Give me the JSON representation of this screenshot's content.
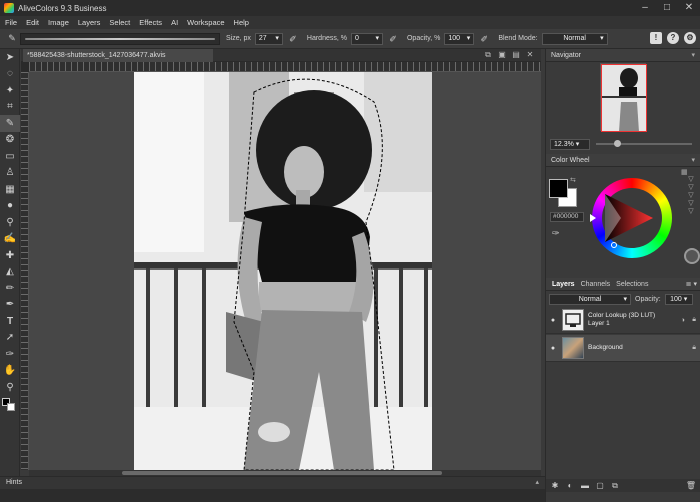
{
  "window": {
    "title": "AliveColors 9.3 Business",
    "min": "–",
    "max": "□",
    "close": "✕"
  },
  "menu": [
    "File",
    "Edit",
    "Image",
    "Layers",
    "Select",
    "Effects",
    "AI",
    "Workspace",
    "Help"
  ],
  "options": {
    "size_label": "Size, px",
    "size_value": "27",
    "hardness_label": "Hardness, %",
    "hardness_value": "0",
    "opacity_label": "Opacity, %",
    "opacity_value": "100",
    "blend_label": "Blend Mode:",
    "blend_value": "Normal"
  },
  "document": {
    "tab_title": "*588425438-shutterstock_1427036477.akvis"
  },
  "panels": {
    "navigator": "Navigator",
    "zoom": "12.3%",
    "color_wheel": "Color Wheel",
    "hex": "#000000"
  },
  "layers": {
    "tabs": [
      "Layers",
      "Channels",
      "Selections"
    ],
    "blend": "Normal",
    "opacity_label": "Opacity:",
    "opacity": "100",
    "items": [
      {
        "name": "Color Lookup (3D LUT)",
        "sub": "Layer 1"
      },
      {
        "name": "Background",
        "sub": ""
      }
    ]
  },
  "hints": "Hints",
  "colors": {
    "accent": "#505050",
    "panel": "#3a3a3a"
  }
}
